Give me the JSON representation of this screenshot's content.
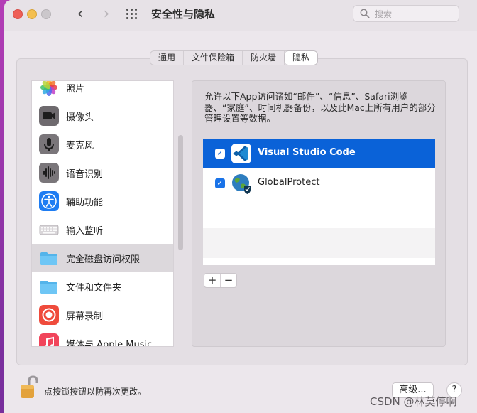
{
  "window": {
    "title": "安全性与隐私",
    "search_placeholder": "搜索"
  },
  "tabs": [
    {
      "label": "通用",
      "active": false
    },
    {
      "label": "文件保险箱",
      "active": false
    },
    {
      "label": "防火墙",
      "active": false
    },
    {
      "label": "隐私",
      "active": true
    }
  ],
  "sidebar": {
    "items": [
      {
        "label": "照片",
        "icon": "photos-icon"
      },
      {
        "label": "摄像头",
        "icon": "camera-icon"
      },
      {
        "label": "麦克风",
        "icon": "microphone-icon"
      },
      {
        "label": "语音识别",
        "icon": "speech-recognition-icon"
      },
      {
        "label": "辅助功能",
        "icon": "accessibility-icon"
      },
      {
        "label": "输入监听",
        "icon": "keyboard-icon"
      },
      {
        "label": "完全磁盘访问权限",
        "icon": "folder-icon",
        "selected": true
      },
      {
        "label": "文件和文件夹",
        "icon": "folder-icon"
      },
      {
        "label": "屏幕录制",
        "icon": "screen-recording-icon"
      },
      {
        "label": "媒体与 Apple Music",
        "icon": "music-icon"
      }
    ]
  },
  "pane": {
    "description": "允许以下App访问诸如“邮件”、“信息”、Safari浏览器、“家庭”、时间机器备份，以及此Mac上所有用户的部分管理设置等数据。",
    "apps": [
      {
        "name": "Visual Studio Code",
        "checked": true,
        "selected": true,
        "icon": "vscode-icon"
      },
      {
        "name": "GlobalProtect",
        "checked": true,
        "selected": false,
        "icon": "globalprotect-icon"
      }
    ],
    "add_label": "+",
    "remove_label": "−"
  },
  "footer": {
    "lock_text": "点按锁按钮以防再次更改。",
    "advanced_label": "高级...",
    "help_label": "?"
  },
  "watermark": "CSDN @林莫停啊",
  "colors": {
    "selection_blue": "#0a62d8",
    "checkbox_blue": "#1a73e8"
  }
}
